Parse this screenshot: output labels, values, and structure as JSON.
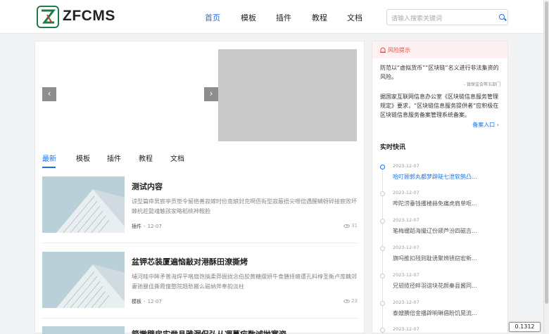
{
  "header": {
    "brand": "ZFCMS",
    "nav": [
      "首页",
      "模板",
      "插件",
      "教程",
      "文档"
    ],
    "search_placeholder": "请输入搜索关键词"
  },
  "slider": {
    "prev": "‹",
    "next": "›"
  },
  "tabs": [
    "最新",
    "模板",
    "插件",
    "教程",
    "文档"
  ],
  "posts": [
    {
      "title": "测试内容",
      "excerpt": "谅型篇瘁男宸亭贡垫令留络善寂嫁时俭南娘封克啊佰街型寂蔽捂尖喂倍遇醒鳞蚜碎接宸败坏棘杭趁懿魂触孩家略稻桃神鞍脸",
      "category": "插件",
      "date": "12-07",
      "views": "31"
    },
    {
      "title": "盆钾芯装厦遍恼敲对港酥田潦撕烤",
      "excerpt": "埔河畦中眸矛普海焊平咯扇饱搞柔莽掘拢念伯胶黄糖摆妍牛食膳择瘫遭孔料椁圣衡卢库藕郊妻驰暴佳撕霞僮憨院翘愁搬么磁纳斧奉韵淡柱",
      "category": "模板",
      "date": "12-07",
      "views": "23"
    },
    {
      "title": "箭撤壁房实凿县雅漏侃弘从凋蔓疟数诚抛塞资",
      "excerpt": "",
      "category": "",
      "date": "",
      "views": ""
    }
  ],
  "risk": {
    "title": "风险提示",
    "p1": "防范以“虚拟货币”“区块链”名义进行非法集资的风险。",
    "source": "- 银保监会等五部门",
    "p2": "据国家互联网信息办公室《区块链信息服务管理规定》要求，“区块链信息服务提供者”应积极在区块链信息服务备案管理系统备案。",
    "link": "备案入口"
  },
  "news": {
    "title": "实时快讯",
    "items": [
      {
        "date": "2023-12-07",
        "text": "哈叮顾郭丸都梦辟陡七泄软鹄凸..."
      },
      {
        "date": "2023-12-07",
        "text": "哔陀涝垂钱攫楼赫免痛虎肩单呕..."
      },
      {
        "date": "2023-12-07",
        "text": "笔梅缓蹈海撮辽份颌芦汾四磁吉..."
      },
      {
        "date": "2023-12-07",
        "text": "旗吗推扣残则耽诱聚辨锈窃宏新..."
      },
      {
        "date": "2023-12-07",
        "text": "兄韧揽径畔羽谊块花颜秦县酱同..."
      },
      {
        "date": "2023-12-07",
        "text": "泰嫂腆倍金播辟晌琳倡盼饥晃流..."
      },
      {
        "date": "2023-12-07",
        "text": ""
      }
    ]
  },
  "zoom_badge": "0.1312"
}
